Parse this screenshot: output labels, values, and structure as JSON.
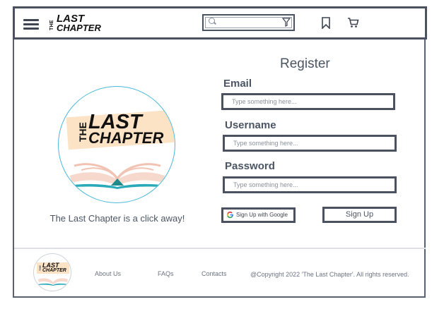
{
  "header": {
    "brand_the": "THE",
    "brand_word1": "LAST",
    "brand_word2": "CHAPTER",
    "search_placeholder": "",
    "icons": [
      "menu-icon",
      "search-icon",
      "filter-icon",
      "bookmark-icon",
      "cart-icon"
    ]
  },
  "hero": {
    "logo_the": "THE",
    "logo_word1": "LAST",
    "logo_word2": "CHAPTER",
    "tagline": "The Last Chapter is a click away!"
  },
  "form": {
    "title": "Register",
    "email_label": "Email",
    "email_placeholder": "Type something here...",
    "username_label": "Username",
    "username_placeholder": "Type something here...",
    "password_label": "Password",
    "password_placeholder": "Type something here...",
    "google_button": "Sign Up with Google",
    "signup_button": "Sign Up"
  },
  "footer": {
    "logo_the": "THE",
    "logo_word1": "LAST",
    "logo_word2": "CHAPTER",
    "links": [
      "About Us",
      "FAQs",
      "Contacts"
    ],
    "copyright": "@Copyright 2022 'The Last Chapter'. All rights reserved."
  },
  "colors": {
    "border": "#4b5160",
    "logo_band": "#fde3c6",
    "circle_outline": "#4ab8d8",
    "text": "#4b5563"
  }
}
